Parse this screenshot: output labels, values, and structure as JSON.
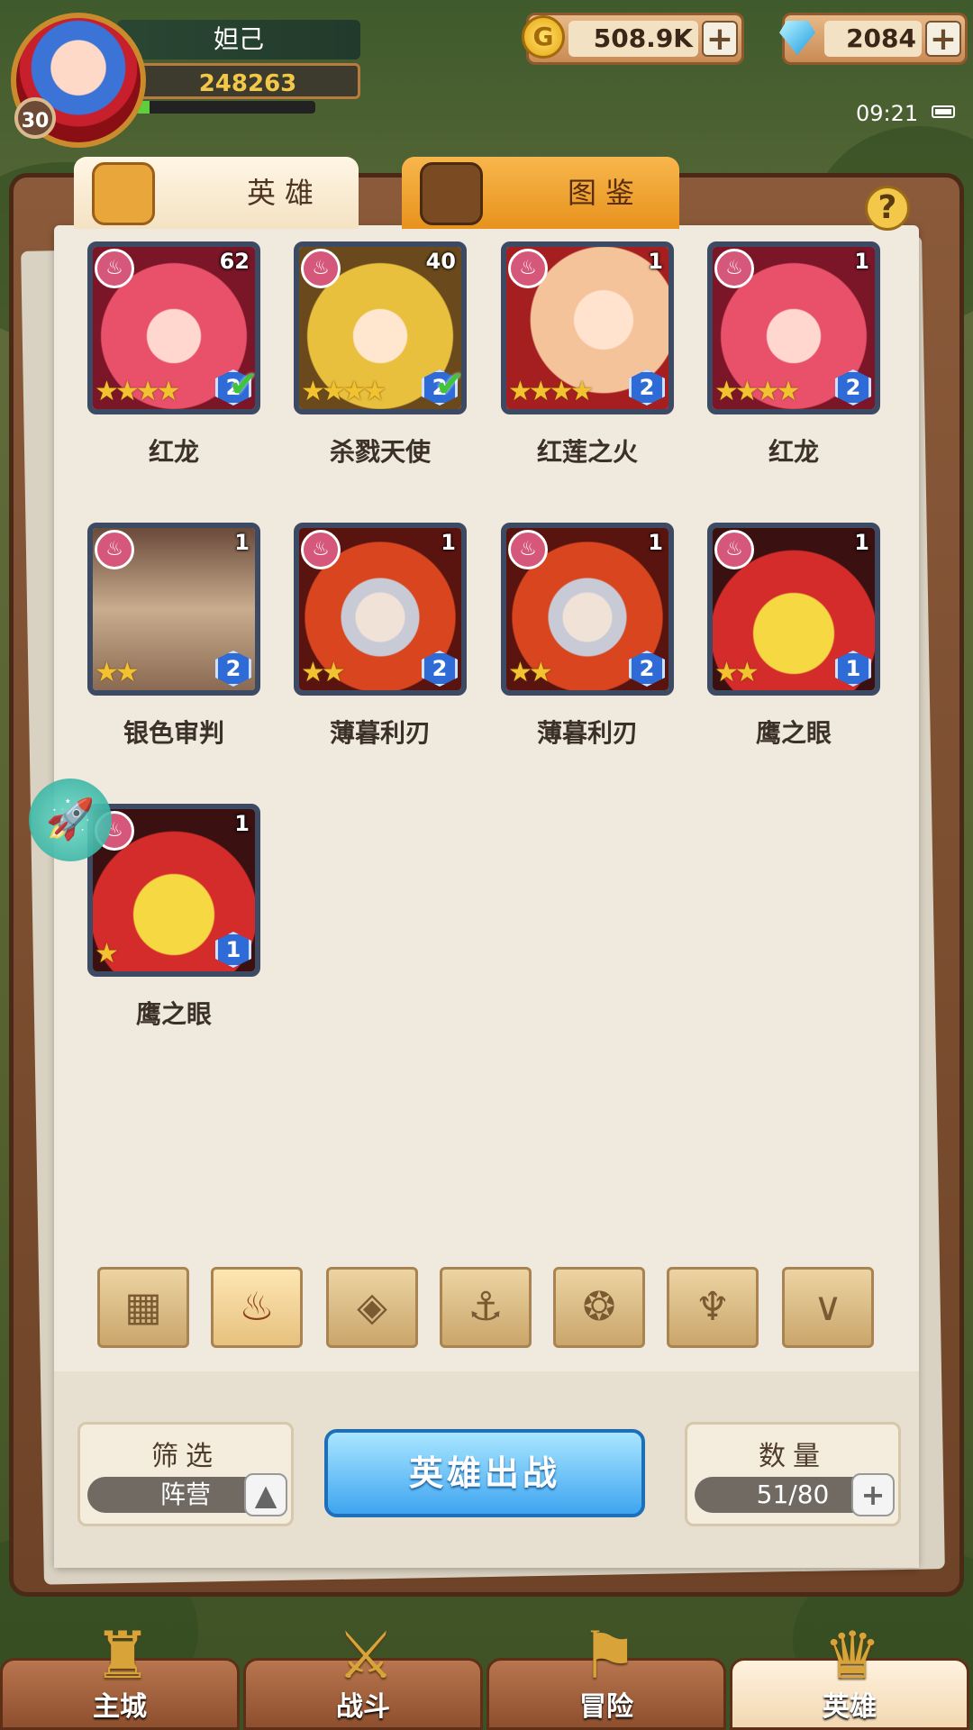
{
  "player": {
    "name": "妲己",
    "level": "30",
    "power": "248263"
  },
  "currency": {
    "gold": "508.9K",
    "gems": "2084",
    "plus": "+"
  },
  "status": {
    "time": "09:21"
  },
  "tabs": {
    "hero": "英雄",
    "dex": "图鉴"
  },
  "help": "?",
  "heroes": [
    {
      "name": "红龙",
      "level": "62",
      "stars": "★★★★",
      "rank": "2",
      "checked": true
    },
    {
      "name": "杀戮天使",
      "level": "40",
      "stars": "★★★★",
      "rank": "2",
      "checked": true
    },
    {
      "name": "红莲之火",
      "level": "1",
      "stars": "★★★★",
      "rank": "2",
      "checked": false
    },
    {
      "name": "红龙",
      "level": "1",
      "stars": "★★★★",
      "rank": "2",
      "checked": false
    },
    {
      "name": "银色审判",
      "level": "1",
      "stars": "★★",
      "rank": "2",
      "checked": false
    },
    {
      "name": "薄暮利刃",
      "level": "1",
      "stars": "★★",
      "rank": "2",
      "checked": false
    },
    {
      "name": "薄暮利刃",
      "level": "1",
      "stars": "★★",
      "rank": "2",
      "checked": false
    },
    {
      "name": "鹰之眼",
      "level": "1",
      "stars": "★★",
      "rank": "1",
      "checked": false
    },
    {
      "name": "鹰之眼",
      "level": "1",
      "stars": "★",
      "rank": "1",
      "checked": false
    }
  ],
  "filter": {
    "title": "筛选",
    "value": "阵营"
  },
  "deploy": "英雄出战",
  "count": {
    "title": "数量",
    "value": "51/80"
  },
  "nav": {
    "city": "主城",
    "battle": "战斗",
    "adventure": "冒险",
    "hero": "英雄"
  }
}
